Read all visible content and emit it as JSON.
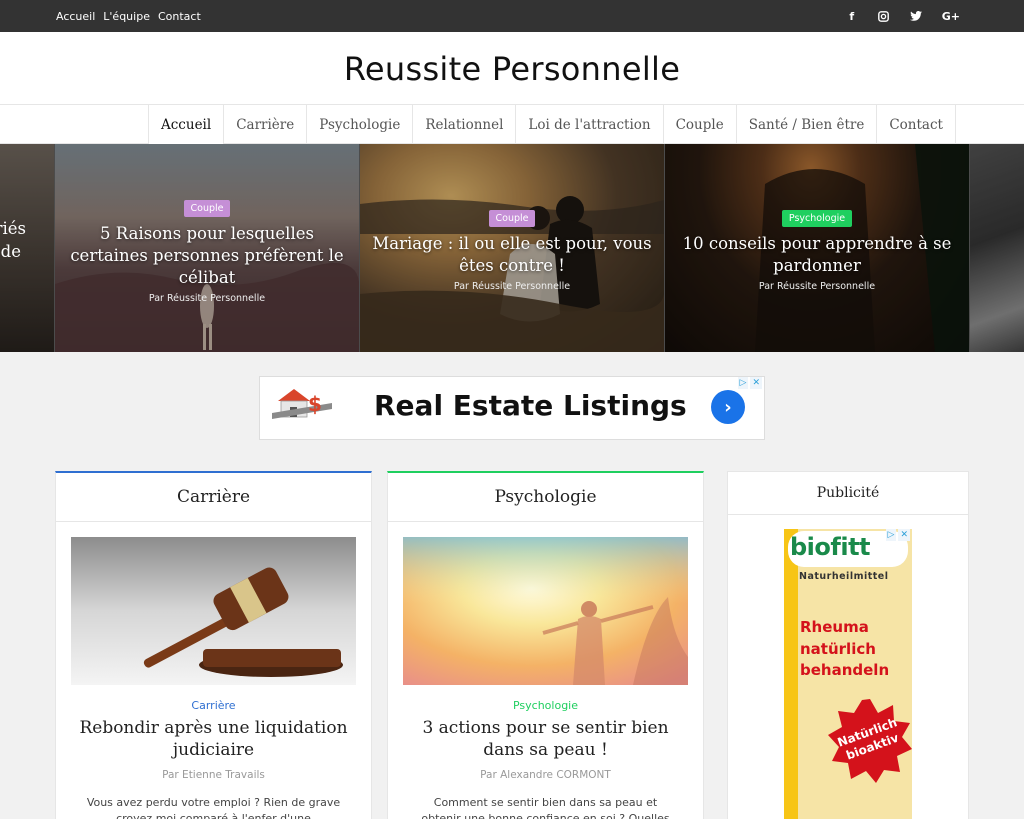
{
  "topbar": {
    "links": [
      "Accueil",
      "L'équipe",
      "Contact"
    ],
    "social_icons": [
      "facebook-icon",
      "instagram-icon",
      "twitter-icon",
      "google-plus-icon"
    ],
    "social_glyphs": [
      "f",
      "◘",
      "t",
      "G+"
    ]
  },
  "header": {
    "title": "Reussite Personnelle"
  },
  "nav": {
    "items": [
      "Accueil",
      "Carrière",
      "Psychologie",
      "Relationnel",
      "Loi de l'attraction",
      "Couple",
      "Santé / Bien être",
      "Contact"
    ],
    "active": "Accueil"
  },
  "slider": {
    "partial_left_text": [
      "riés",
      "de"
    ],
    "slides": [
      {
        "badge": "Couple",
        "badge_color": "#c58fd6",
        "title": "5 Raisons pour lesquelles certaines personnes préfèrent le célibat",
        "author": "Par Réussite Personnelle"
      },
      {
        "badge": "Couple",
        "badge_color": "#c58fd6",
        "title": "Mariage : il ou elle est pour, vous êtes contre !",
        "author": "Par Réussite Personnelle"
      },
      {
        "badge": "Psychologie",
        "badge_color": "#1fcf5f",
        "title": "10 conseils pour apprendre à se pardonner",
        "author": "Par Réussite Personnelle"
      }
    ]
  },
  "banner_ad": {
    "text": "Real Estate Listings",
    "arrow": "›",
    "marks": [
      "▷",
      "✕"
    ]
  },
  "cards": [
    {
      "heading": "Carrière",
      "accent": "#2f6fd1",
      "category": "Carrière",
      "category_color": "#2f6fd1",
      "title": "Rebondir après une liquidation judiciaire",
      "author": "Par Etienne Travails",
      "excerpt": "Vous avez perdu votre emploi ? Rien de grave croyez moi comparé à l'enfer d'une"
    },
    {
      "heading": "Psychologie",
      "accent": "#1fcf5f",
      "category": "Psychologie",
      "category_color": "#1fcf5f",
      "title": "3 actions pour se sentir bien dans sa peau !",
      "author": "Par Alexandre CORMONT",
      "excerpt": "Comment se sentir bien dans sa peau et obtenir une bonne confiance en soi ? Quelles"
    }
  ],
  "sidebar": {
    "heading": "Publicité",
    "ad": {
      "brand": "biofitt",
      "tagline": "Naturheilmittel",
      "headline": [
        "Rheuma",
        "natürlich",
        "behandeln"
      ],
      "badge": [
        "Natürlich",
        "bioaktiv"
      ],
      "marks": [
        "▷",
        "✕"
      ]
    }
  }
}
